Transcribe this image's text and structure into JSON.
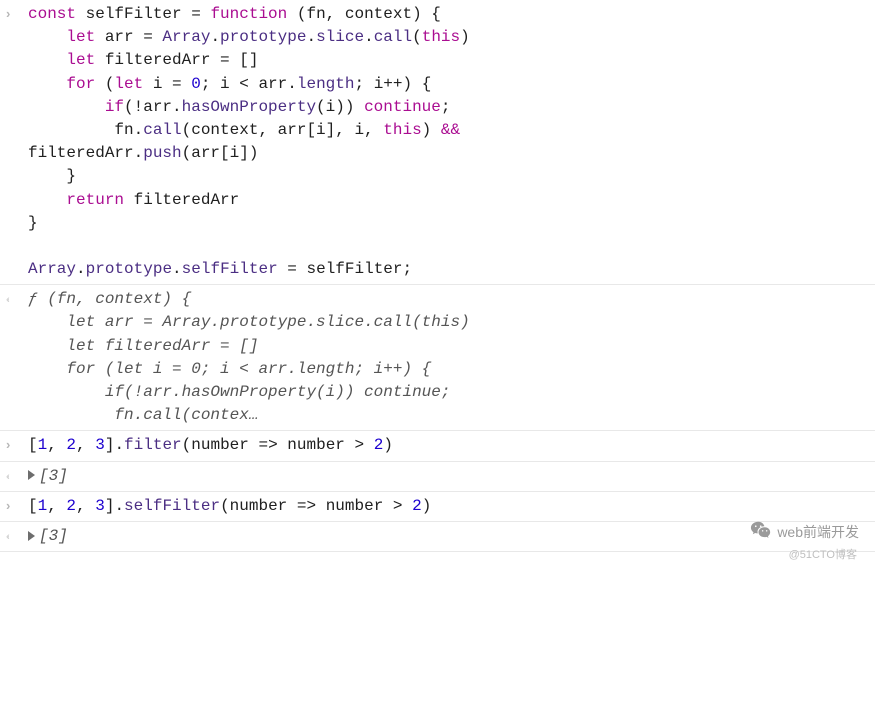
{
  "console": {
    "entries": [
      {
        "kind": "input",
        "tokens": [
          {
            "t": "const ",
            "c": "kw"
          },
          {
            "t": "selfFilter ",
            "c": "dk"
          },
          {
            "t": "= ",
            "c": "op"
          },
          {
            "t": "function ",
            "c": "kw"
          },
          {
            "t": "(fn, context) {\n",
            "c": "dk"
          },
          {
            "t": "    ",
            "c": "dk"
          },
          {
            "t": "let ",
            "c": "kw"
          },
          {
            "t": "arr ",
            "c": "dk"
          },
          {
            "t": "= ",
            "c": "op"
          },
          {
            "t": "Array",
            "c": "prop"
          },
          {
            "t": ".",
            "c": "dk"
          },
          {
            "t": "prototype",
            "c": "prop"
          },
          {
            "t": ".",
            "c": "dk"
          },
          {
            "t": "slice",
            "c": "prop"
          },
          {
            "t": ".",
            "c": "dk"
          },
          {
            "t": "call",
            "c": "prop"
          },
          {
            "t": "(",
            "c": "dk"
          },
          {
            "t": "this",
            "c": "this"
          },
          {
            "t": ")\n",
            "c": "dk"
          },
          {
            "t": "    ",
            "c": "dk"
          },
          {
            "t": "let ",
            "c": "kw"
          },
          {
            "t": "filteredArr ",
            "c": "dk"
          },
          {
            "t": "= ",
            "c": "op"
          },
          {
            "t": "[]\n",
            "c": "dk"
          },
          {
            "t": "    ",
            "c": "dk"
          },
          {
            "t": "for ",
            "c": "kw"
          },
          {
            "t": "(",
            "c": "dk"
          },
          {
            "t": "let ",
            "c": "kw"
          },
          {
            "t": "i ",
            "c": "dk"
          },
          {
            "t": "= ",
            "c": "op"
          },
          {
            "t": "0",
            "c": "num"
          },
          {
            "t": "; i ",
            "c": "dk"
          },
          {
            "t": "< ",
            "c": "op"
          },
          {
            "t": "arr",
            "c": "dk"
          },
          {
            "t": ".",
            "c": "dk"
          },
          {
            "t": "length",
            "c": "prop"
          },
          {
            "t": "; i",
            "c": "dk"
          },
          {
            "t": "++",
            "c": "op"
          },
          {
            "t": ") {\n",
            "c": "dk"
          },
          {
            "t": "        ",
            "c": "dk"
          },
          {
            "t": "if",
            "c": "kw"
          },
          {
            "t": "(!arr.",
            "c": "dk"
          },
          {
            "t": "hasOwnProperty",
            "c": "prop"
          },
          {
            "t": "(i)) ",
            "c": "dk"
          },
          {
            "t": "continue",
            "c": "kw"
          },
          {
            "t": ";\n",
            "c": "dk"
          },
          {
            "t": "         fn.",
            "c": "dk"
          },
          {
            "t": "call",
            "c": "prop"
          },
          {
            "t": "(context, arr[i], i, ",
            "c": "dk"
          },
          {
            "t": "this",
            "c": "this"
          },
          {
            "t": ") ",
            "c": "dk"
          },
          {
            "t": "&&",
            "c": "kw"
          },
          {
            "t": "\n",
            "c": "dk"
          },
          {
            "t": "filteredArr.",
            "c": "dk"
          },
          {
            "t": "push",
            "c": "prop"
          },
          {
            "t": "(arr[i])\n",
            "c": "dk"
          },
          {
            "t": "    }\n",
            "c": "dk"
          },
          {
            "t": "    ",
            "c": "dk"
          },
          {
            "t": "return ",
            "c": "kw"
          },
          {
            "t": "filteredArr\n",
            "c": "dk"
          },
          {
            "t": "}\n\n",
            "c": "dk"
          },
          {
            "t": "Array",
            "c": "prop"
          },
          {
            "t": ".",
            "c": "dk"
          },
          {
            "t": "prototype",
            "c": "prop"
          },
          {
            "t": ".",
            "c": "dk"
          },
          {
            "t": "selfFilter ",
            "c": "prop"
          },
          {
            "t": "= ",
            "c": "op"
          },
          {
            "t": "selfFilter;",
            "c": "dk"
          }
        ]
      },
      {
        "kind": "output",
        "italic": true,
        "tokens": [
          {
            "t": "ƒ (fn, context) {\n",
            "c": "italic"
          },
          {
            "t": "    let arr = Array.prototype.slice.call(this)\n",
            "c": "italic"
          },
          {
            "t": "    let filteredArr = []\n",
            "c": "italic"
          },
          {
            "t": "    for (let i = 0; i < arr.length; i++) {\n",
            "c": "italic"
          },
          {
            "t": "        if(!arr.hasOwnProperty(i)) continue;\n",
            "c": "italic"
          },
          {
            "t": "         fn.call(contex…",
            "c": "italic"
          }
        ]
      },
      {
        "kind": "input",
        "tokens": [
          {
            "t": "[",
            "c": "dk"
          },
          {
            "t": "1",
            "c": "num"
          },
          {
            "t": ", ",
            "c": "dk"
          },
          {
            "t": "2",
            "c": "num"
          },
          {
            "t": ", ",
            "c": "dk"
          },
          {
            "t": "3",
            "c": "num"
          },
          {
            "t": "].",
            "c": "dk"
          },
          {
            "t": "filter",
            "c": "prop"
          },
          {
            "t": "(number ",
            "c": "dk"
          },
          {
            "t": "=> ",
            "c": "op"
          },
          {
            "t": "number ",
            "c": "dk"
          },
          {
            "t": "> ",
            "c": "op"
          },
          {
            "t": "2",
            "c": "num"
          },
          {
            "t": ")",
            "c": "dk"
          }
        ]
      },
      {
        "kind": "output",
        "expandable": true,
        "tokens": [
          {
            "t": "[3]",
            "c": "italic"
          }
        ]
      },
      {
        "kind": "input",
        "tokens": [
          {
            "t": "[",
            "c": "dk"
          },
          {
            "t": "1",
            "c": "num"
          },
          {
            "t": ", ",
            "c": "dk"
          },
          {
            "t": "2",
            "c": "num"
          },
          {
            "t": ", ",
            "c": "dk"
          },
          {
            "t": "3",
            "c": "num"
          },
          {
            "t": "].",
            "c": "dk"
          },
          {
            "t": "selfFilter",
            "c": "prop"
          },
          {
            "t": "(number ",
            "c": "dk"
          },
          {
            "t": "=> ",
            "c": "op"
          },
          {
            "t": "number ",
            "c": "dk"
          },
          {
            "t": "> ",
            "c": "op"
          },
          {
            "t": "2",
            "c": "num"
          },
          {
            "t": ")",
            "c": "dk"
          }
        ]
      },
      {
        "kind": "output",
        "expandable": true,
        "tokens": [
          {
            "t": "[3]",
            "c": "italic"
          }
        ]
      }
    ]
  },
  "watermark": {
    "label": "web前端开发",
    "sub": "@51CTO博客"
  }
}
